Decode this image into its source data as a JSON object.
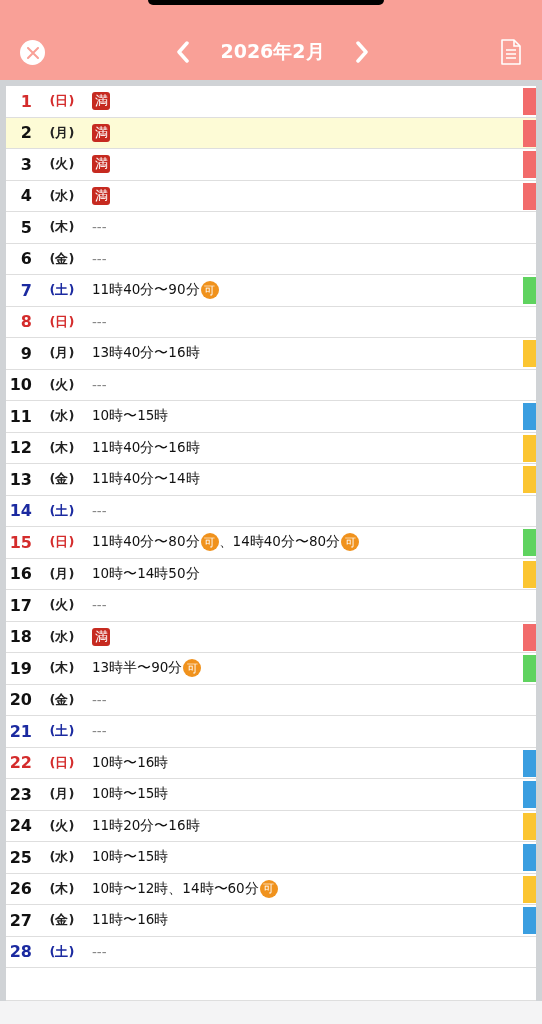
{
  "header": {
    "title": "2026年2月"
  },
  "days": [
    {
      "date": "1",
      "weekday": "(日)",
      "kind": "sunday",
      "selected": false,
      "color": "#f26b6b",
      "entries": [
        {
          "kind": "full",
          "badge": "満"
        }
      ]
    },
    {
      "date": "2",
      "weekday": "(月)",
      "kind": "weekday",
      "selected": true,
      "color": "#f26b6b",
      "entries": [
        {
          "kind": "full",
          "badge": "満"
        }
      ]
    },
    {
      "date": "3",
      "weekday": "(火)",
      "kind": "weekday",
      "selected": false,
      "color": "#f26b6b",
      "entries": [
        {
          "kind": "full",
          "badge": "満"
        }
      ]
    },
    {
      "date": "4",
      "weekday": "(水)",
      "kind": "weekday",
      "selected": false,
      "color": "#f26b6b",
      "entries": [
        {
          "kind": "full",
          "badge": "満"
        }
      ]
    },
    {
      "date": "5",
      "weekday": "(木)",
      "kind": "weekday",
      "selected": false,
      "entries": [
        {
          "kind": "none",
          "text": "---"
        }
      ]
    },
    {
      "date": "6",
      "weekday": "(金)",
      "kind": "weekday",
      "selected": false,
      "entries": [
        {
          "kind": "none",
          "text": "---"
        }
      ]
    },
    {
      "date": "7",
      "weekday": "(土)",
      "kind": "saturday",
      "selected": false,
      "color": "#5fd35f",
      "entries": [
        {
          "kind": "time",
          "text": "11時40分〜90分",
          "badge": "可"
        }
      ]
    },
    {
      "date": "8",
      "weekday": "(日)",
      "kind": "sunday",
      "selected": false,
      "entries": [
        {
          "kind": "none",
          "text": "---"
        }
      ]
    },
    {
      "date": "9",
      "weekday": "(月)",
      "kind": "weekday",
      "selected": false,
      "color": "#fbc531",
      "entries": [
        {
          "kind": "time",
          "text": "13時40分〜16時"
        }
      ]
    },
    {
      "date": "10",
      "weekday": "(火)",
      "kind": "weekday",
      "selected": false,
      "entries": [
        {
          "kind": "none",
          "text": "---"
        }
      ]
    },
    {
      "date": "11",
      "weekday": "(水)",
      "kind": "weekday",
      "selected": false,
      "color": "#3a9ee0",
      "entries": [
        {
          "kind": "time",
          "text": "10時〜15時"
        }
      ]
    },
    {
      "date": "12",
      "weekday": "(木)",
      "kind": "weekday",
      "selected": false,
      "color": "#fbc531",
      "entries": [
        {
          "kind": "time",
          "text": "11時40分〜16時"
        }
      ]
    },
    {
      "date": "13",
      "weekday": "(金)",
      "kind": "weekday",
      "selected": false,
      "color": "#fbc531",
      "entries": [
        {
          "kind": "time",
          "text": "11時40分〜14時"
        }
      ]
    },
    {
      "date": "14",
      "weekday": "(土)",
      "kind": "saturday",
      "selected": false,
      "entries": [
        {
          "kind": "none",
          "text": "---"
        }
      ]
    },
    {
      "date": "15",
      "weekday": "(日)",
      "kind": "sunday",
      "selected": false,
      "color": "#5fd35f",
      "entries": [
        {
          "kind": "time",
          "text": "11時40分〜80分",
          "badge": "可"
        },
        {
          "kind": "time",
          "text": "、14時40分〜80分",
          "badge": "可"
        }
      ]
    },
    {
      "date": "16",
      "weekday": "(月)",
      "kind": "weekday",
      "selected": false,
      "color": "#fbc531",
      "entries": [
        {
          "kind": "time",
          "text": "10時〜14時50分"
        }
      ]
    },
    {
      "date": "17",
      "weekday": "(火)",
      "kind": "weekday",
      "selected": false,
      "entries": [
        {
          "kind": "none",
          "text": "---"
        }
      ]
    },
    {
      "date": "18",
      "weekday": "(水)",
      "kind": "weekday",
      "selected": false,
      "color": "#f26b6b",
      "entries": [
        {
          "kind": "full",
          "badge": "満"
        }
      ]
    },
    {
      "date": "19",
      "weekday": "(木)",
      "kind": "weekday",
      "selected": false,
      "color": "#5fd35f",
      "entries": [
        {
          "kind": "time",
          "text": "13時半〜90分",
          "badge": "可"
        }
      ]
    },
    {
      "date": "20",
      "weekday": "(金)",
      "kind": "weekday",
      "selected": false,
      "entries": [
        {
          "kind": "none",
          "text": "---"
        }
      ]
    },
    {
      "date": "21",
      "weekday": "(土)",
      "kind": "saturday",
      "selected": false,
      "entries": [
        {
          "kind": "none",
          "text": "---"
        }
      ]
    },
    {
      "date": "22",
      "weekday": "(日)",
      "kind": "sunday",
      "selected": false,
      "color": "#3a9ee0",
      "entries": [
        {
          "kind": "time",
          "text": "10時〜16時"
        }
      ]
    },
    {
      "date": "23",
      "weekday": "(月)",
      "kind": "weekday",
      "selected": false,
      "color": "#3a9ee0",
      "entries": [
        {
          "kind": "time",
          "text": "10時〜15時"
        }
      ]
    },
    {
      "date": "24",
      "weekday": "(火)",
      "kind": "weekday",
      "selected": false,
      "color": "#fbc531",
      "entries": [
        {
          "kind": "time",
          "text": "11時20分〜16時"
        }
      ]
    },
    {
      "date": "25",
      "weekday": "(水)",
      "kind": "weekday",
      "selected": false,
      "color": "#3a9ee0",
      "entries": [
        {
          "kind": "time",
          "text": "10時〜15時"
        }
      ]
    },
    {
      "date": "26",
      "weekday": "(木)",
      "kind": "weekday",
      "selected": false,
      "color": "#fbc531",
      "entries": [
        {
          "kind": "time",
          "text": "10時〜12時、14時〜60分",
          "badge": "可"
        }
      ]
    },
    {
      "date": "27",
      "weekday": "(金)",
      "kind": "weekday",
      "selected": false,
      "color": "#3a9ee0",
      "entries": [
        {
          "kind": "time",
          "text": "11時〜16時"
        }
      ]
    },
    {
      "date": "28",
      "weekday": "(土)",
      "kind": "saturday",
      "selected": false,
      "entries": [
        {
          "kind": "none",
          "text": "---"
        }
      ]
    }
  ]
}
